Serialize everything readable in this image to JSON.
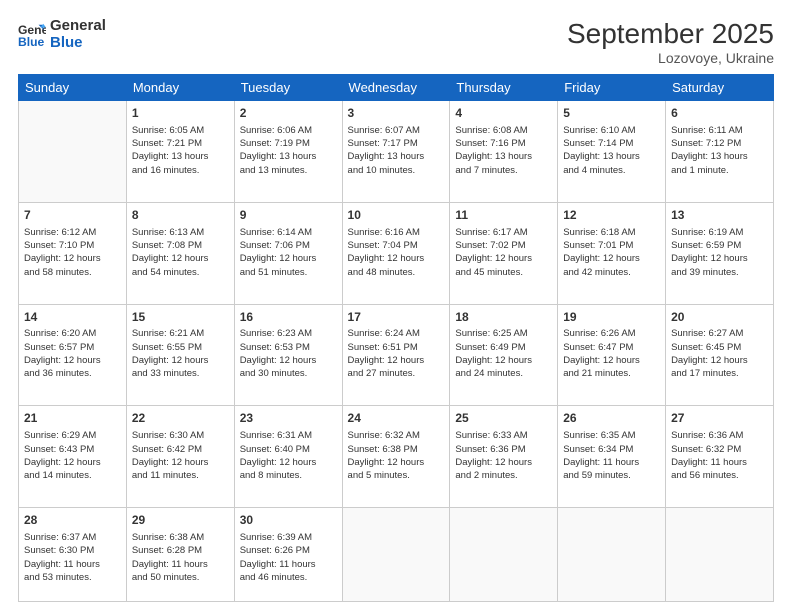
{
  "logo": {
    "line1": "General",
    "line2": "Blue"
  },
  "title": "September 2025",
  "location": "Lozovoye, Ukraine",
  "weekdays": [
    "Sunday",
    "Monday",
    "Tuesday",
    "Wednesday",
    "Thursday",
    "Friday",
    "Saturday"
  ],
  "weeks": [
    [
      {
        "day": "",
        "info": ""
      },
      {
        "day": "1",
        "info": "Sunrise: 6:05 AM\nSunset: 7:21 PM\nDaylight: 13 hours\nand 16 minutes."
      },
      {
        "day": "2",
        "info": "Sunrise: 6:06 AM\nSunset: 7:19 PM\nDaylight: 13 hours\nand 13 minutes."
      },
      {
        "day": "3",
        "info": "Sunrise: 6:07 AM\nSunset: 7:17 PM\nDaylight: 13 hours\nand 10 minutes."
      },
      {
        "day": "4",
        "info": "Sunrise: 6:08 AM\nSunset: 7:16 PM\nDaylight: 13 hours\nand 7 minutes."
      },
      {
        "day": "5",
        "info": "Sunrise: 6:10 AM\nSunset: 7:14 PM\nDaylight: 13 hours\nand 4 minutes."
      },
      {
        "day": "6",
        "info": "Sunrise: 6:11 AM\nSunset: 7:12 PM\nDaylight: 13 hours\nand 1 minute."
      }
    ],
    [
      {
        "day": "7",
        "info": "Sunrise: 6:12 AM\nSunset: 7:10 PM\nDaylight: 12 hours\nand 58 minutes."
      },
      {
        "day": "8",
        "info": "Sunrise: 6:13 AM\nSunset: 7:08 PM\nDaylight: 12 hours\nand 54 minutes."
      },
      {
        "day": "9",
        "info": "Sunrise: 6:14 AM\nSunset: 7:06 PM\nDaylight: 12 hours\nand 51 minutes."
      },
      {
        "day": "10",
        "info": "Sunrise: 6:16 AM\nSunset: 7:04 PM\nDaylight: 12 hours\nand 48 minutes."
      },
      {
        "day": "11",
        "info": "Sunrise: 6:17 AM\nSunset: 7:02 PM\nDaylight: 12 hours\nand 45 minutes."
      },
      {
        "day": "12",
        "info": "Sunrise: 6:18 AM\nSunset: 7:01 PM\nDaylight: 12 hours\nand 42 minutes."
      },
      {
        "day": "13",
        "info": "Sunrise: 6:19 AM\nSunset: 6:59 PM\nDaylight: 12 hours\nand 39 minutes."
      }
    ],
    [
      {
        "day": "14",
        "info": "Sunrise: 6:20 AM\nSunset: 6:57 PM\nDaylight: 12 hours\nand 36 minutes."
      },
      {
        "day": "15",
        "info": "Sunrise: 6:21 AM\nSunset: 6:55 PM\nDaylight: 12 hours\nand 33 minutes."
      },
      {
        "day": "16",
        "info": "Sunrise: 6:23 AM\nSunset: 6:53 PM\nDaylight: 12 hours\nand 30 minutes."
      },
      {
        "day": "17",
        "info": "Sunrise: 6:24 AM\nSunset: 6:51 PM\nDaylight: 12 hours\nand 27 minutes."
      },
      {
        "day": "18",
        "info": "Sunrise: 6:25 AM\nSunset: 6:49 PM\nDaylight: 12 hours\nand 24 minutes."
      },
      {
        "day": "19",
        "info": "Sunrise: 6:26 AM\nSunset: 6:47 PM\nDaylight: 12 hours\nand 21 minutes."
      },
      {
        "day": "20",
        "info": "Sunrise: 6:27 AM\nSunset: 6:45 PM\nDaylight: 12 hours\nand 17 minutes."
      }
    ],
    [
      {
        "day": "21",
        "info": "Sunrise: 6:29 AM\nSunset: 6:43 PM\nDaylight: 12 hours\nand 14 minutes."
      },
      {
        "day": "22",
        "info": "Sunrise: 6:30 AM\nSunset: 6:42 PM\nDaylight: 12 hours\nand 11 minutes."
      },
      {
        "day": "23",
        "info": "Sunrise: 6:31 AM\nSunset: 6:40 PM\nDaylight: 12 hours\nand 8 minutes."
      },
      {
        "day": "24",
        "info": "Sunrise: 6:32 AM\nSunset: 6:38 PM\nDaylight: 12 hours\nand 5 minutes."
      },
      {
        "day": "25",
        "info": "Sunrise: 6:33 AM\nSunset: 6:36 PM\nDaylight: 12 hours\nand 2 minutes."
      },
      {
        "day": "26",
        "info": "Sunrise: 6:35 AM\nSunset: 6:34 PM\nDaylight: 11 hours\nand 59 minutes."
      },
      {
        "day": "27",
        "info": "Sunrise: 6:36 AM\nSunset: 6:32 PM\nDaylight: 11 hours\nand 56 minutes."
      }
    ],
    [
      {
        "day": "28",
        "info": "Sunrise: 6:37 AM\nSunset: 6:30 PM\nDaylight: 11 hours\nand 53 minutes."
      },
      {
        "day": "29",
        "info": "Sunrise: 6:38 AM\nSunset: 6:28 PM\nDaylight: 11 hours\nand 50 minutes."
      },
      {
        "day": "30",
        "info": "Sunrise: 6:39 AM\nSunset: 6:26 PM\nDaylight: 11 hours\nand 46 minutes."
      },
      {
        "day": "",
        "info": ""
      },
      {
        "day": "",
        "info": ""
      },
      {
        "day": "",
        "info": ""
      },
      {
        "day": "",
        "info": ""
      }
    ]
  ]
}
